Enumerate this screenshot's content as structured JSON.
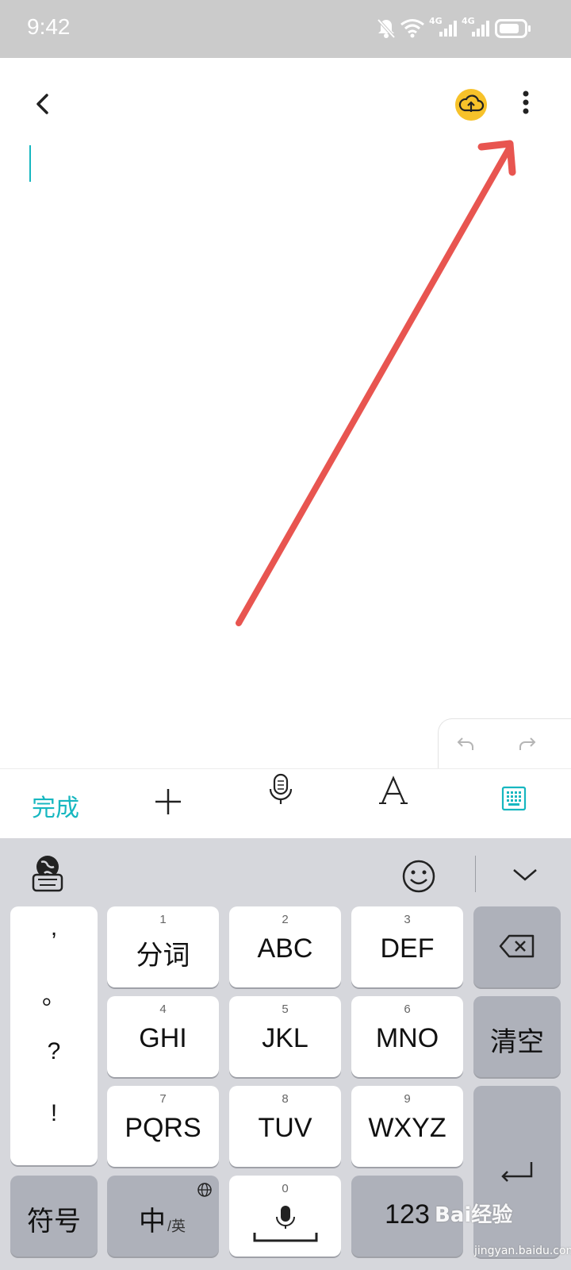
{
  "status_bar": {
    "time": "9:42",
    "net1": "4G",
    "net2": "4G"
  },
  "toolbar": {
    "done_label": "完成"
  },
  "keyboard": {
    "punctuation": [
      ",",
      "。",
      "?",
      "!"
    ],
    "keys": [
      {
        "num": "1",
        "label": "分词"
      },
      {
        "num": "2",
        "label": "ABC"
      },
      {
        "num": "3",
        "label": "DEF"
      },
      {
        "num": "4",
        "label": "GHI"
      },
      {
        "num": "5",
        "label": "JKL"
      },
      {
        "num": "6",
        "label": "MNO"
      },
      {
        "num": "7",
        "label": "PQRS"
      },
      {
        "num": "8",
        "label": "TUV"
      },
      {
        "num": "9",
        "label": "WXYZ"
      }
    ],
    "clear_label": "清空",
    "symbols_label": "符号",
    "lang_main": "中",
    "lang_sub": "/英",
    "space_num": "0",
    "num_label": "123"
  },
  "watermark": {
    "text": "Bai经验",
    "sub": "jingyan.baidu.com"
  },
  "colors": {
    "accent": "#17b7c0",
    "annotation_arrow": "#e85550",
    "cloud": "#f7c22a"
  },
  "icons": [
    "back-icon",
    "cloud-upload-icon",
    "more-vert-icon",
    "undo-icon",
    "redo-icon",
    "plus-icon",
    "mic-icon",
    "font-icon",
    "keyboard-grid-icon",
    "globe-keyboard-icon",
    "emoji-icon",
    "chevron-down-icon",
    "backspace-icon",
    "enter-icon"
  ]
}
